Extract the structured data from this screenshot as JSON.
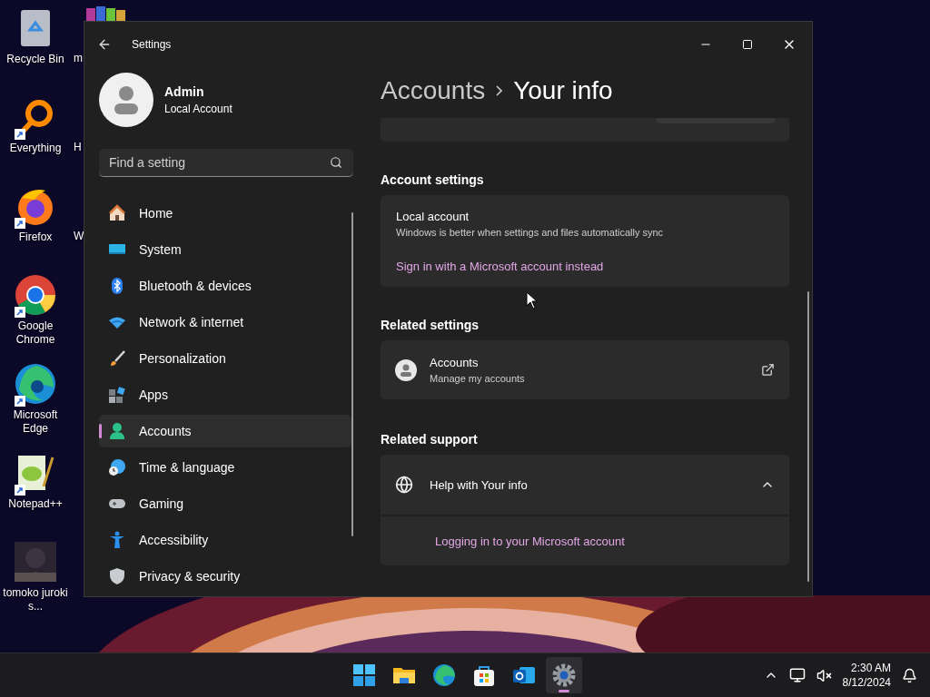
{
  "desktop": {
    "icons": [
      {
        "label": "Recycle Bin",
        "kind": "recycle",
        "shortcut": false
      },
      {
        "label": "Everything",
        "kind": "everything",
        "shortcut": true
      },
      {
        "label": "Firefox",
        "kind": "firefox",
        "shortcut": true
      },
      {
        "label": "Google Chrome",
        "kind": "chrome",
        "shortcut": true
      },
      {
        "label": "Microsoft Edge",
        "kind": "edge",
        "shortcut": true
      },
      {
        "label": "Notepad++",
        "kind": "notepad",
        "shortcut": true
      },
      {
        "label": "tomoko juroki s...",
        "shortcut": false
      }
    ],
    "second_column": [
      "m",
      "H",
      "W"
    ]
  },
  "window": {
    "title": "Settings",
    "profile": {
      "name": "Admin",
      "subtitle": "Local Account"
    },
    "search": {
      "placeholder": "Find a setting"
    },
    "nav": [
      {
        "label": "Home",
        "kind": "home",
        "selected": false
      },
      {
        "label": "System",
        "kind": "system",
        "selected": false
      },
      {
        "label": "Bluetooth & devices",
        "kind": "bluetooth",
        "selected": false
      },
      {
        "label": "Network & internet",
        "kind": "network",
        "selected": false
      },
      {
        "label": "Personalization",
        "kind": "brush",
        "selected": false
      },
      {
        "label": "Apps",
        "kind": "apps",
        "selected": false
      },
      {
        "label": "Accounts",
        "kind": "accounts",
        "selected": true
      },
      {
        "label": "Time & language",
        "kind": "time",
        "selected": false
      },
      {
        "label": "Gaming",
        "kind": "gaming",
        "selected": false
      },
      {
        "label": "Accessibility",
        "kind": "accessibility",
        "selected": false
      },
      {
        "label": "Privacy & security",
        "kind": "privacy",
        "selected": false
      }
    ],
    "breadcrumb": [
      "Accounts",
      "Your info"
    ],
    "account_settings": {
      "heading": "Account settings",
      "title": "Local account",
      "description": "Windows is better when settings and files automatically sync",
      "link": "Sign in with a Microsoft account instead"
    },
    "related_settings": {
      "heading": "Related settings",
      "items": [
        {
          "title": "Accounts",
          "subtitle": "Manage my accounts"
        }
      ]
    },
    "related_support": {
      "heading": "Related support",
      "title": "Help with Your info",
      "expanded": true,
      "links": [
        "Logging in to your Microsoft account"
      ]
    }
  },
  "taskbar": {
    "apps": [
      {
        "kind": "start",
        "selected": false
      },
      {
        "kind": "explorer",
        "selected": false
      },
      {
        "kind": "edge",
        "selected": false
      },
      {
        "kind": "store",
        "selected": false
      },
      {
        "kind": "outlook",
        "selected": false
      },
      {
        "kind": "settings",
        "selected": true
      }
    ],
    "time": "2:30 AM",
    "date": "8/12/2024"
  }
}
